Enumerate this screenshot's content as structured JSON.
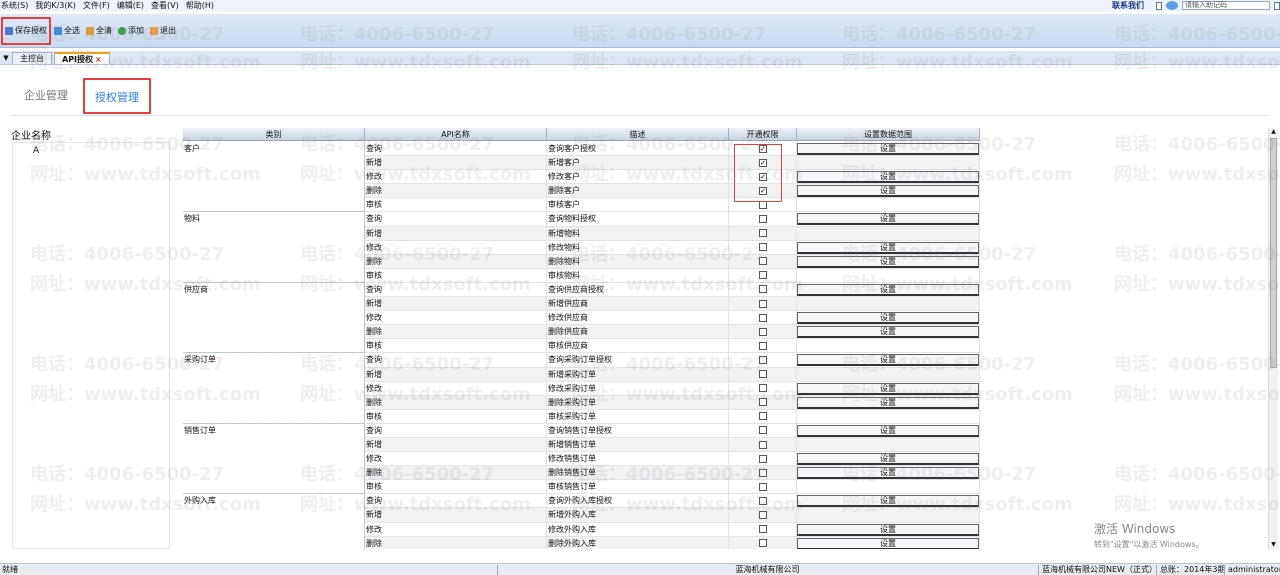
{
  "menu": [
    "系统(S)",
    "我的K/3(K)",
    "文件(F)",
    "编辑(E)",
    "查看(V)",
    "帮助(H)"
  ],
  "menu_right": {
    "contact": "联系我们",
    "search_placeholder": "请输入助记码"
  },
  "toolbar": {
    "save": "保存授权",
    "select_all": "全选",
    "clear_all": "全清",
    "add": "添加",
    "exit": "退出"
  },
  "tabs": {
    "main": "主控台",
    "api": "API授权",
    "close": "×"
  },
  "subtabs": {
    "enterprise": "企业管理",
    "auth": "授权管理"
  },
  "left": {
    "title": "企业名称",
    "items": [
      "A"
    ]
  },
  "grid": {
    "headers": [
      "类别",
      "API名称",
      "描述",
      "开通权限",
      "设置数据范围"
    ],
    "set_label": "设置",
    "groups": [
      {
        "category": "客户",
        "rows": [
          {
            "op": "查询",
            "desc": "查询客户授权",
            "checked": true,
            "set": true
          },
          {
            "op": "新增",
            "desc": "新增客户",
            "checked": true,
            "set": false
          },
          {
            "op": "修改",
            "desc": "修改客户",
            "checked": true,
            "set": true
          },
          {
            "op": "删除",
            "desc": "删除客户",
            "checked": true,
            "set": true
          },
          {
            "op": "审核",
            "desc": "审核客户",
            "checked": false,
            "set": false
          }
        ]
      },
      {
        "category": "物料",
        "rows": [
          {
            "op": "查询",
            "desc": "查询物料授权",
            "checked": false,
            "set": true
          },
          {
            "op": "新增",
            "desc": "新增物料",
            "checked": false,
            "set": false
          },
          {
            "op": "修改",
            "desc": "修改物料",
            "checked": false,
            "set": true
          },
          {
            "op": "删除",
            "desc": "删除物料",
            "checked": false,
            "set": true
          },
          {
            "op": "审核",
            "desc": "审核物料",
            "checked": false,
            "set": false
          }
        ]
      },
      {
        "category": "供应商",
        "rows": [
          {
            "op": "查询",
            "desc": "查询供应商授权",
            "checked": false,
            "set": true
          },
          {
            "op": "新增",
            "desc": "新增供应商",
            "checked": false,
            "set": false
          },
          {
            "op": "修改",
            "desc": "修改供应商",
            "checked": false,
            "set": true
          },
          {
            "op": "删除",
            "desc": "删除供应商",
            "checked": false,
            "set": true
          },
          {
            "op": "审核",
            "desc": "审核供应商",
            "checked": false,
            "set": false
          }
        ]
      },
      {
        "category": "采购订单",
        "rows": [
          {
            "op": "查询",
            "desc": "查询采购订单授权",
            "checked": false,
            "set": true
          },
          {
            "op": "新增",
            "desc": "新增采购订单",
            "checked": false,
            "set": false
          },
          {
            "op": "修改",
            "desc": "修改采购订单",
            "checked": false,
            "set": true
          },
          {
            "op": "删除",
            "desc": "删除采购订单",
            "checked": false,
            "set": true
          },
          {
            "op": "审核",
            "desc": "审核采购订单",
            "checked": false,
            "set": false
          }
        ]
      },
      {
        "category": "销售订单",
        "rows": [
          {
            "op": "查询",
            "desc": "查询销售订单授权",
            "checked": false,
            "set": true
          },
          {
            "op": "新增",
            "desc": "新增销售订单",
            "checked": false,
            "set": false
          },
          {
            "op": "修改",
            "desc": "修改销售订单",
            "checked": false,
            "set": true
          },
          {
            "op": "删除",
            "desc": "删除销售订单",
            "checked": false,
            "set": true
          },
          {
            "op": "审核",
            "desc": "审核销售订单",
            "checked": false,
            "set": false
          }
        ]
      },
      {
        "category": "外购入库",
        "rows": [
          {
            "op": "查询",
            "desc": "查询外购入库授权",
            "checked": false,
            "set": true
          },
          {
            "op": "新增",
            "desc": "新增外购入库",
            "checked": false,
            "set": false
          },
          {
            "op": "修改",
            "desc": "修改外购入库",
            "checked": false,
            "set": true
          },
          {
            "op": "删除",
            "desc": "删除外购入库",
            "checked": false,
            "set": true
          }
        ]
      }
    ]
  },
  "watermark": {
    "phone": "电话：4006-6500-27",
    "web": "网址：www.tdxsoft.com"
  },
  "activation": {
    "title": "激活 Windows",
    "sub": "转到\"设置\"以激活 Windows。"
  },
  "status": {
    "ready": "就绪",
    "company": "蓝海机械有限公司",
    "account": "蓝海机械有限公司NEW（正式）",
    "period": "总账：2014年3期",
    "user": "administrator"
  },
  "colors": {
    "highlight": "#e54040",
    "link": "#2d7ee8",
    "toolbar": "#c9d9ef"
  }
}
